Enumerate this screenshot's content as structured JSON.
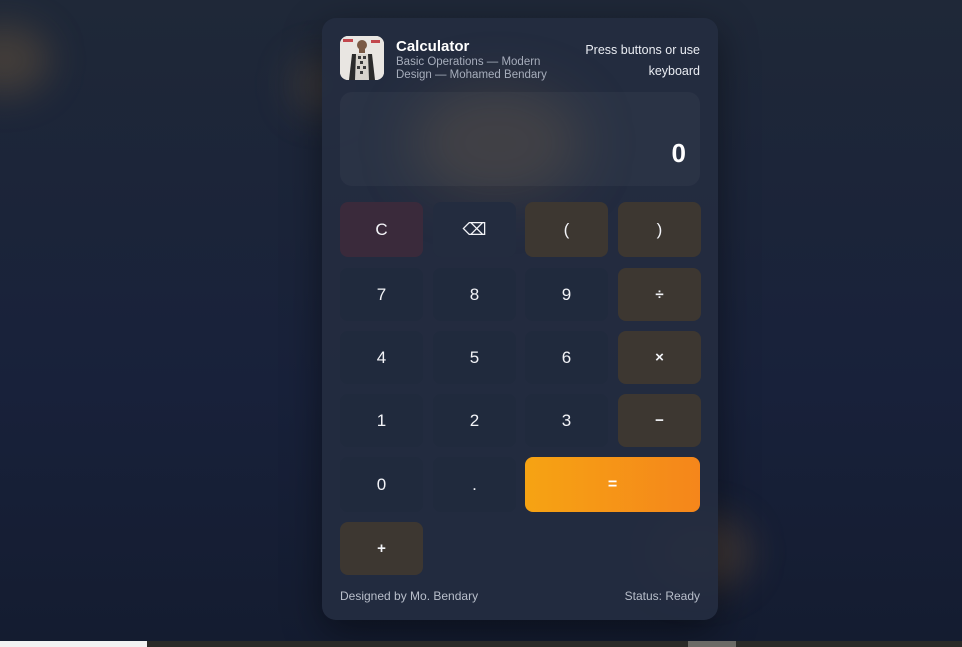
{
  "app": {
    "title": "Calculator",
    "subtitle": "Basic Operations — Modern Design — Mohamed Bendary",
    "hint": "Press buttons or use keyboard"
  },
  "display": {
    "value": "0"
  },
  "keys": {
    "clear": "C",
    "backspace": "⌫",
    "paren_open": "(",
    "paren_close": ")",
    "seven": "7",
    "eight": "8",
    "nine": "9",
    "divide": "÷",
    "four": "4",
    "five": "5",
    "six": "6",
    "multiply": "×",
    "one": "1",
    "two": "2",
    "three": "3",
    "minus": "−",
    "zero": "0",
    "decimal": ".",
    "equals": "=",
    "plus": "+"
  },
  "footer": {
    "credit": "Designed by Mo. Bendary",
    "status": "Status: Ready"
  },
  "colors": {
    "accent_start": "#f6a313",
    "accent_end": "#f5861b",
    "card": "#242d40",
    "operator_key": "#3d3731",
    "number_key": "#202a3d",
    "clear_key": "#3a2a3b"
  }
}
